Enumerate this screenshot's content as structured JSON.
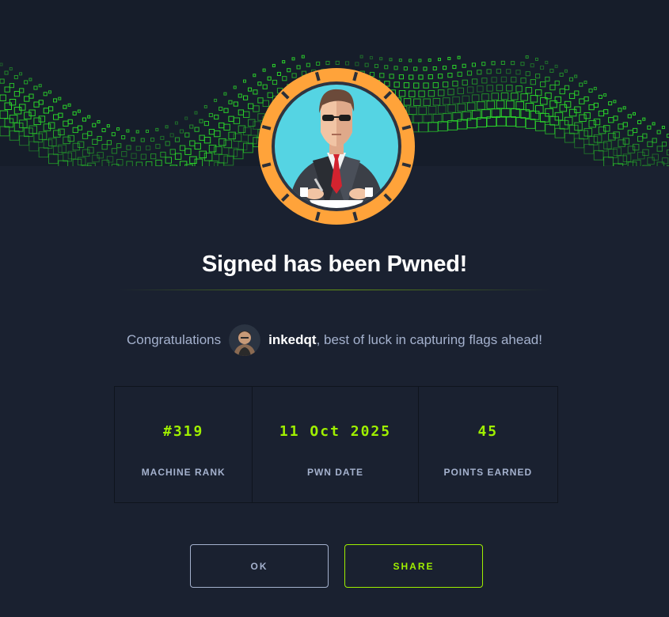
{
  "dialog": {
    "title": "Signed has been Pwned!",
    "congrats_prefix": "Congratulations",
    "username": "inkedqt",
    "congrats_suffix": ", best of luck in capturing flags ahead!"
  },
  "stats": [
    {
      "value": "#319",
      "label": "MACHINE RANK"
    },
    {
      "value": "11 Oct 2025",
      "label": "PWN DATE"
    },
    {
      "value": "45",
      "label": "POINTS EARNED"
    }
  ],
  "buttons": {
    "ok": "OK",
    "share": "SHARE"
  },
  "colors": {
    "background": "#1a2130",
    "accent": "#9fef00",
    "muted_text": "#a4b1cd",
    "badge_ring": "#ffa33a",
    "badge_face": "#55d4e3"
  },
  "icons": {
    "banner": "green-cube-wave-graphic",
    "badge": "machine-avatar-businessman-signing",
    "user_avatar": "user-avatar"
  }
}
